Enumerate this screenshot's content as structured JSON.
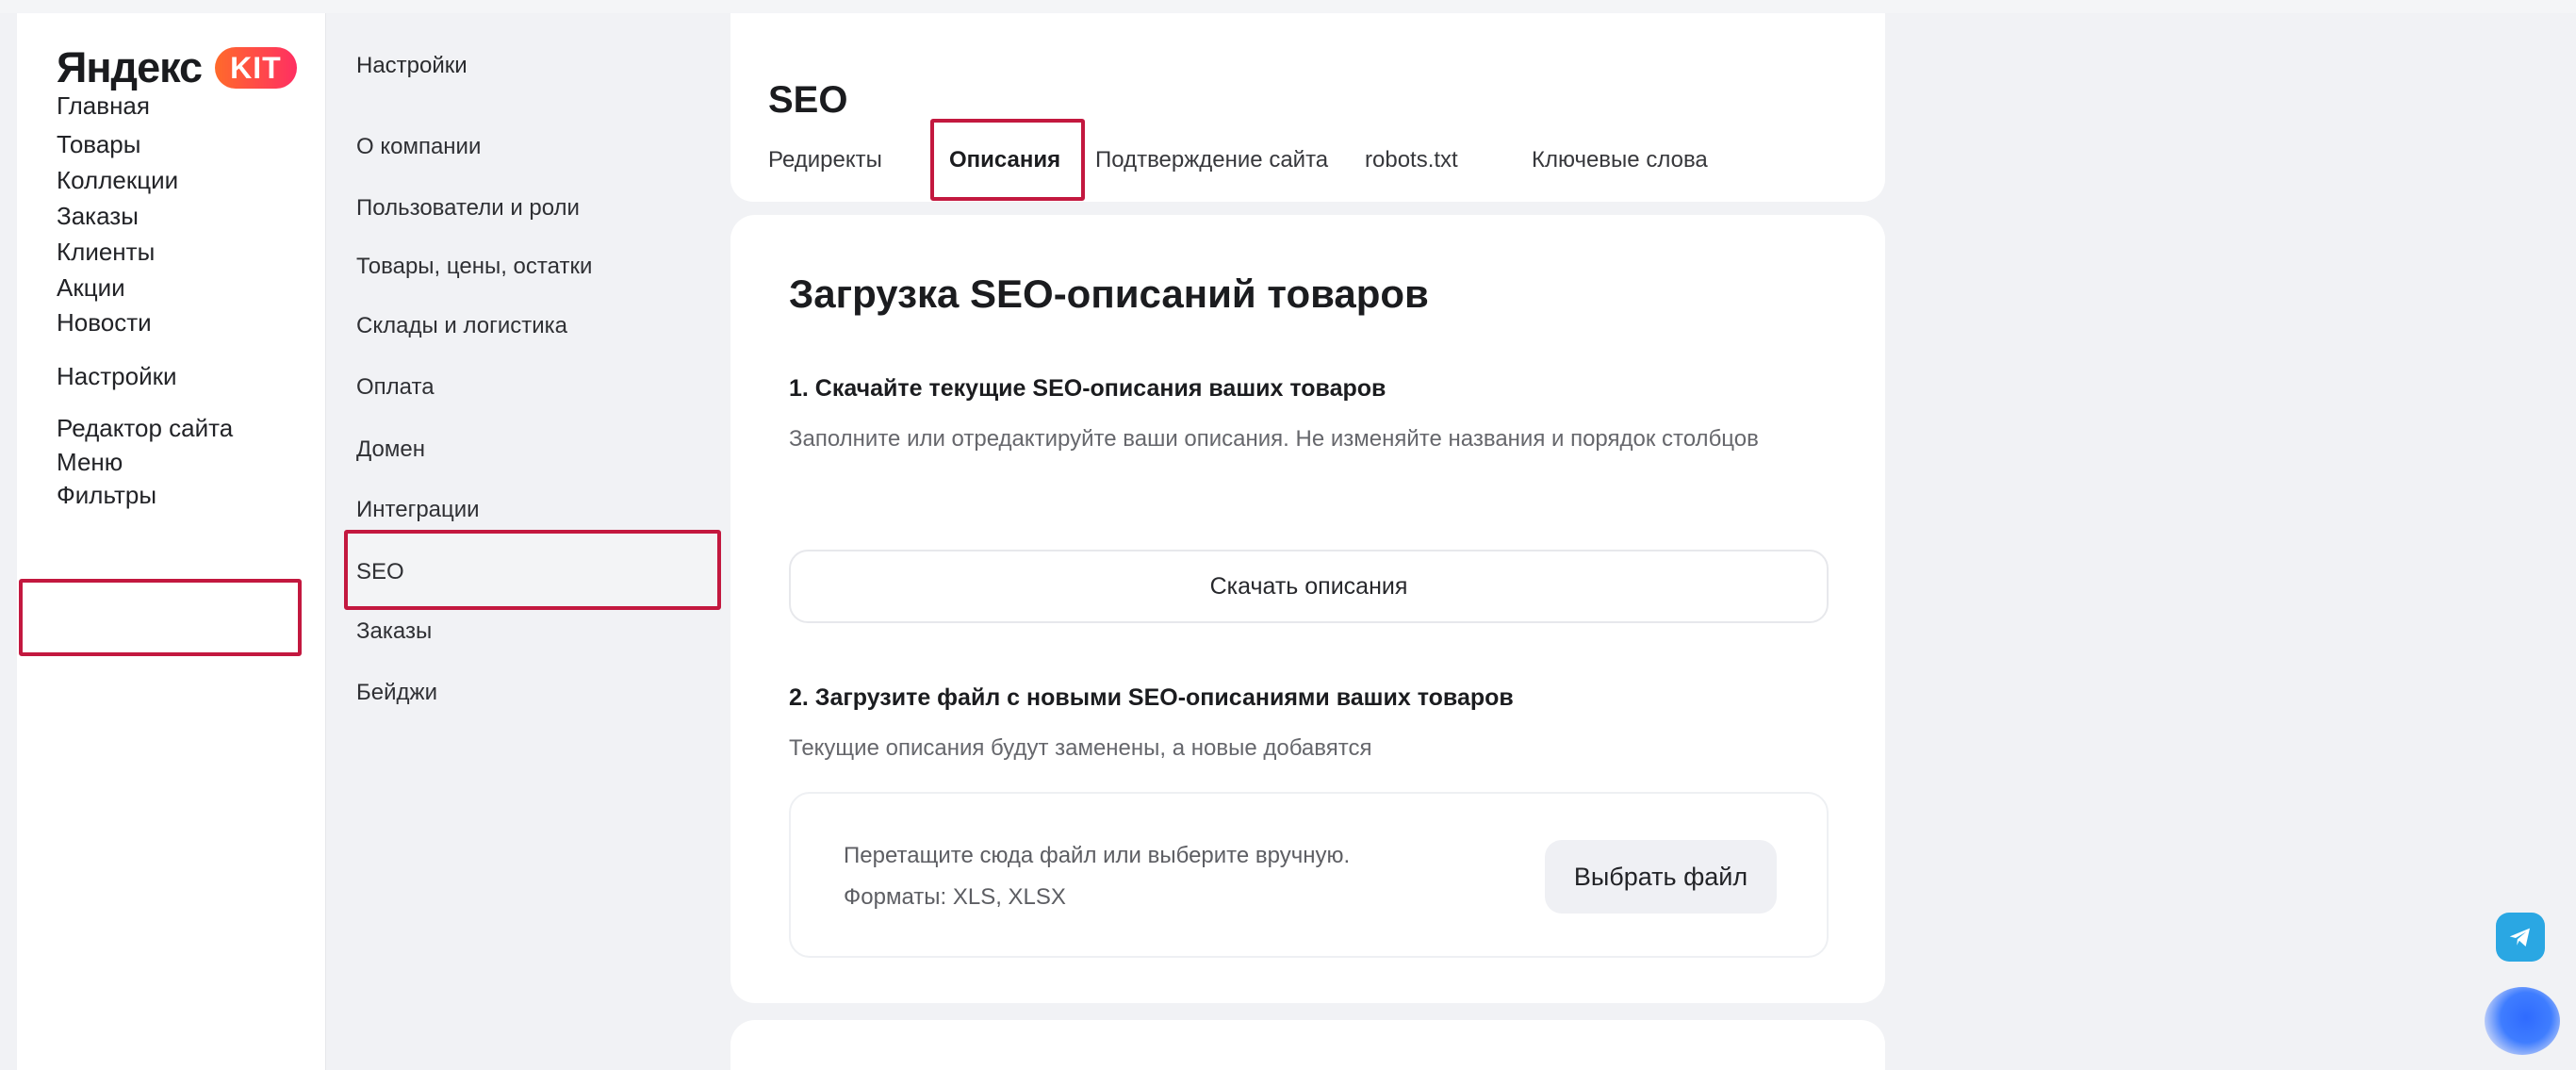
{
  "logo": {
    "text": "Яндекс",
    "badge": "KIT"
  },
  "main_nav": {
    "items": [
      {
        "label": "Главная"
      },
      {
        "label": "Товары"
      },
      {
        "label": "Коллекции"
      },
      {
        "label": "Заказы"
      },
      {
        "label": "Клиенты"
      },
      {
        "label": "Акции"
      },
      {
        "label": "Новости"
      },
      {
        "label": "Настройки",
        "selected": true
      },
      {
        "label": "Редактор сайта"
      },
      {
        "label": "Меню"
      },
      {
        "label": "Фильтры"
      }
    ]
  },
  "settings_nav": {
    "title": "Настройки",
    "items": [
      {
        "label": "О компании"
      },
      {
        "label": "Пользователи и роли"
      },
      {
        "label": "Товары, цены, остатки"
      },
      {
        "label": "Склады и логистика"
      },
      {
        "label": "Оплата"
      },
      {
        "label": "Домен"
      },
      {
        "label": "Интеграции"
      },
      {
        "label": "SEO",
        "selected": true
      },
      {
        "label": "Заказы"
      },
      {
        "label": "Бейджи"
      }
    ]
  },
  "header": {
    "title": "SEO",
    "tabs": [
      {
        "label": "Редиректы"
      },
      {
        "label": "Описания",
        "active": true
      },
      {
        "label": "Подтверждение сайта"
      },
      {
        "label": "robots.txt"
      },
      {
        "label": "Ключевые слова"
      }
    ]
  },
  "content": {
    "title": "Загрузка SEO-описаний товаров",
    "step1": {
      "title": "1. Скачайте текущие SEO-описания ваших товаров",
      "hint": "Заполните или отредактируйте ваши описания. Не изменяйте названия и порядок столбцов",
      "button": "Скачать описания"
    },
    "step2": {
      "title": "2. Загрузите файл с новыми SEO-описаниями ваших товаров",
      "hint": "Текущие описания будут заменены, а новые добавятся",
      "dropzone_line1": "Перетащите сюда файл или выберите вручную.",
      "dropzone_line2": "Форматы: XLS, XLSX",
      "file_button": "Выбрать файл"
    }
  },
  "colors": {
    "highlight": "#c3183f",
    "accent_gradient_start": "#ff6a2b",
    "accent_gradient_end": "#ff2f62",
    "telegram": "#2aa7e3",
    "assistant": "#2f6bff"
  },
  "icons": {
    "telegram": "telegram-icon",
    "assistant": "assistant-icon"
  }
}
